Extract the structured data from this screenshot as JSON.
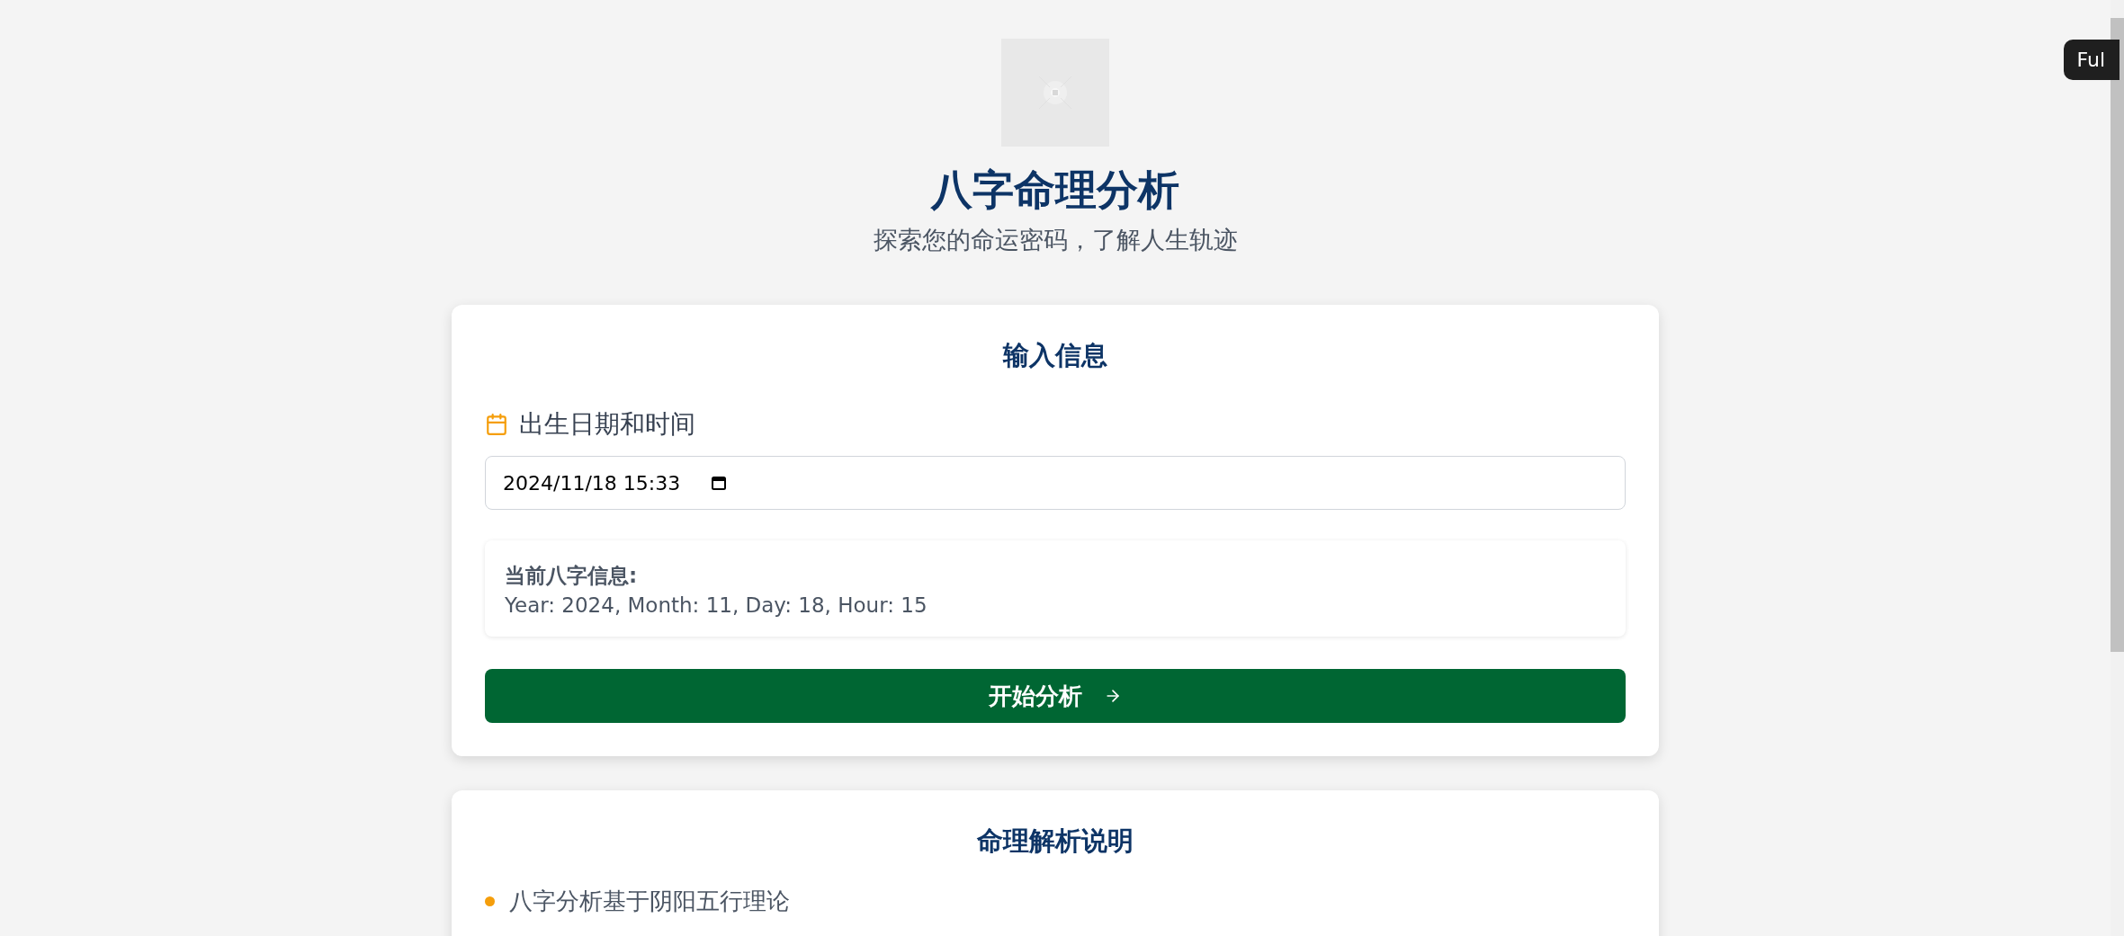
{
  "header": {
    "title": "八字命理分析",
    "subtitle": "探索您的命运密码，了解人生轨迹"
  },
  "input_card": {
    "title": "输入信息",
    "field_label": "出生日期和时间",
    "datetime_value": "2024/11/18 15:33",
    "info": {
      "heading": "当前八字信息:",
      "text": "Year: 2024, Month: 11, Day: 18, Hour: 15"
    },
    "submit_button": "开始分析"
  },
  "explain_card": {
    "title": "命理解析说明",
    "items": [
      "八字分析基于阴阳五行理论"
    ]
  },
  "tooltip": "Ful"
}
